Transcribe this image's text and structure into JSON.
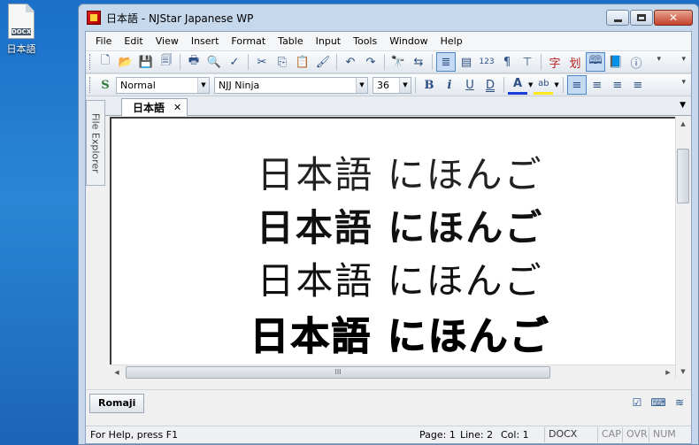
{
  "desktop": {
    "icon_tag": "DOCX",
    "icon_label": "日本語"
  },
  "window": {
    "title": "日本語 - NJStar Japanese WP",
    "minimize_glyph": "–",
    "close_glyph": "✕"
  },
  "menu": [
    "File",
    "Edit",
    "View",
    "Insert",
    "Format",
    "Table",
    "Input",
    "Tools",
    "Window",
    "Help"
  ],
  "toolbar1": {
    "icons": [
      "new-file-icon",
      "open-folder-icon",
      "save-icon",
      "save-all-icon",
      "print-icon",
      "print-preview-icon",
      "spellcheck-icon",
      "cut-icon",
      "copy-icon",
      "paste-icon",
      "format-painter-icon",
      "undo-icon",
      "redo-icon",
      "find-icon",
      "replace-icon",
      "paragraph-marks-icon",
      "columns-icon",
      "line-numbers-icon",
      "pilcrow-icon",
      "show-hide-icon",
      "kanji-char-icon",
      "word-stroke-icon",
      "dictionary-icon",
      "book-icon",
      "info-icon"
    ],
    "glyphs": [
      "🗋",
      "📂",
      "💾",
      "🗐",
      "🖶",
      "🔍",
      "✓",
      "✂",
      "⎘",
      "📋",
      "🖌",
      "↶",
      "↷",
      "🔭",
      "⇆",
      "≣",
      "▤",
      "123",
      "¶",
      "⊤",
      "字",
      "划",
      "🕮",
      "📘",
      "ⓘ"
    ]
  },
  "toolbar2": {
    "style_value": "Normal",
    "font_value": "NJJ Ninja",
    "size_value": "36",
    "bold": "B",
    "italic": "i",
    "underline": "U",
    "double_underline": "D",
    "font_color": "A",
    "highlight": "ab"
  },
  "tabs": {
    "active_label": "日本語",
    "close_glyph": "✕",
    "dropdown_glyph": "▼"
  },
  "side_panel": {
    "label": "File Explorer"
  },
  "editor": {
    "lines": [
      "日本語 にほんご",
      "日本語 にほんご",
      "日本語 にほんご",
      "日本語 にほんご"
    ]
  },
  "scroll": {
    "up": "▲",
    "down": "▼",
    "left": "◀",
    "right": "▶",
    "thumb_grip": "III"
  },
  "bottom_bar": {
    "romaji_label": "Romaji"
  },
  "status": {
    "help": "For Help, press F1",
    "page": "Page: 1",
    "line": "Line: 2",
    "col": "Col: 1",
    "format": "DOCX",
    "cap": "CAP",
    "ovr": "OVR",
    "num": "NUM"
  }
}
